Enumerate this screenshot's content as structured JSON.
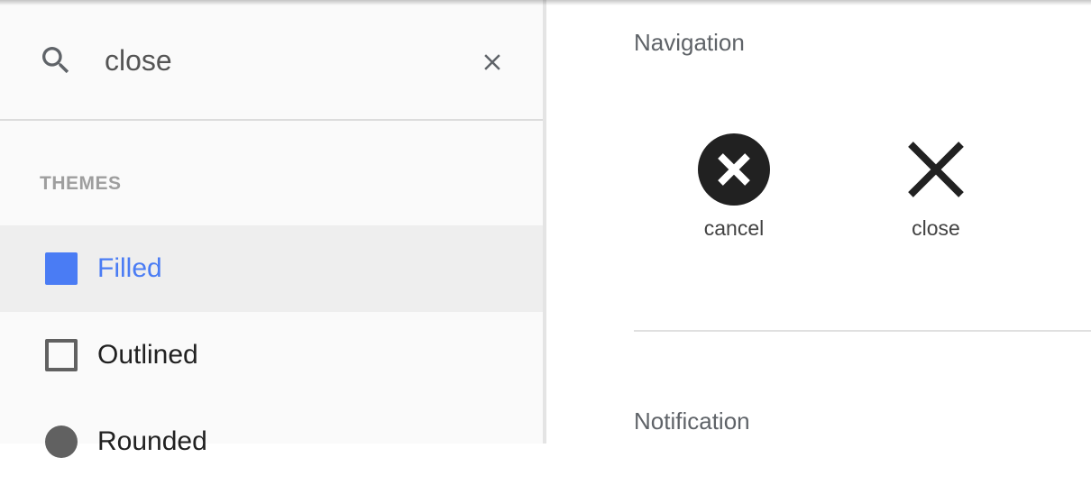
{
  "search": {
    "value": "close",
    "icon": "search-icon",
    "clear_icon": "close-icon"
  },
  "sidebar": {
    "themes_heading": "THEMES",
    "themes": [
      {
        "label": "Filled",
        "icon": "filled-square",
        "selected": true
      },
      {
        "label": "Outlined",
        "icon": "outlined-square",
        "selected": false
      },
      {
        "label": "Rounded",
        "icon": "rounded-circle",
        "selected": false
      }
    ]
  },
  "main": {
    "sections": [
      {
        "title": "Navigation",
        "icons": [
          {
            "label": "cancel",
            "icon": "cancel-icon"
          },
          {
            "label": "close",
            "icon": "close-icon"
          }
        ]
      },
      {
        "title": "Notification",
        "icons": []
      }
    ]
  },
  "colors": {
    "accent": "#4a7cf4",
    "icon_dark": "#212121",
    "selected_row_bg": "#eeeeee",
    "sidebar_bg": "#fafafa"
  }
}
